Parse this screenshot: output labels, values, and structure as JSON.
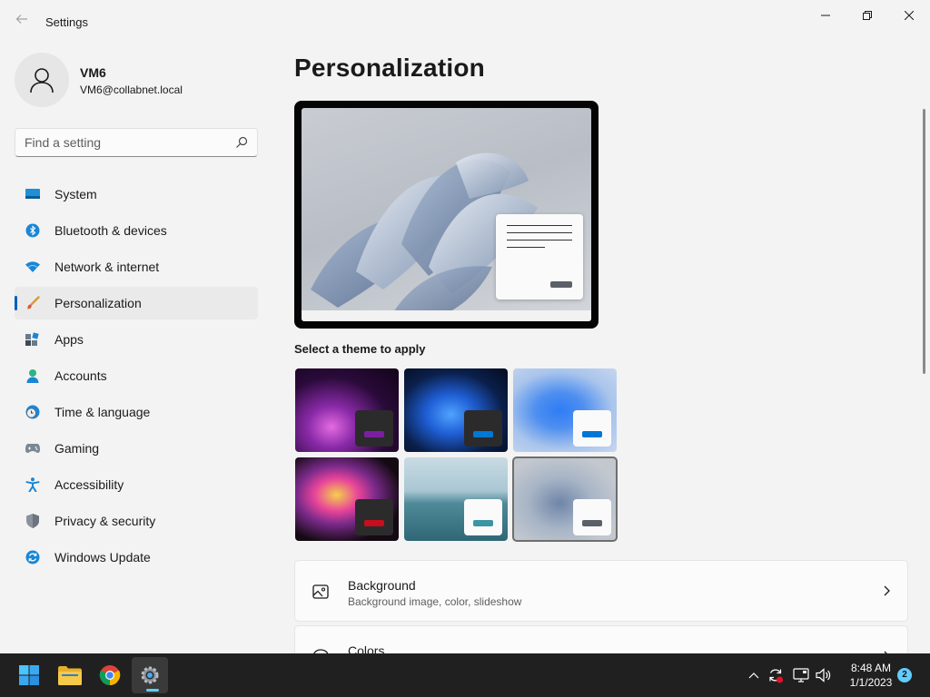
{
  "window": {
    "title": "Settings",
    "controls": [
      "minimize",
      "maximize",
      "close"
    ]
  },
  "profile": {
    "name": "VM6",
    "email": "VM6@collabnet.local"
  },
  "search": {
    "placeholder": "Find a setting",
    "value": ""
  },
  "sidebar": {
    "items": [
      {
        "label": "System",
        "icon": "system-icon"
      },
      {
        "label": "Bluetooth & devices",
        "icon": "bluetooth-icon"
      },
      {
        "label": "Network & internet",
        "icon": "wifi-icon"
      },
      {
        "label": "Personalization",
        "icon": "brush-icon",
        "selected": true
      },
      {
        "label": "Apps",
        "icon": "apps-icon"
      },
      {
        "label": "Accounts",
        "icon": "accounts-icon"
      },
      {
        "label": "Time & language",
        "icon": "clock-globe-icon"
      },
      {
        "label": "Gaming",
        "icon": "gamepad-icon"
      },
      {
        "label": "Accessibility",
        "icon": "accessibility-icon"
      },
      {
        "label": "Privacy & security",
        "icon": "shield-icon"
      },
      {
        "label": "Windows Update",
        "icon": "update-icon"
      }
    ]
  },
  "main": {
    "title": "Personalization",
    "theme_section_label": "Select a theme to apply",
    "themes": [
      {
        "name": "glow-purple",
        "accent": "#7a1fa2"
      },
      {
        "name": "bloom-dark",
        "accent": "#0078d4"
      },
      {
        "name": "bloom-light",
        "accent": "#0078d4"
      },
      {
        "name": "captured-motion",
        "accent": "#c50f1f"
      },
      {
        "name": "flow-lake",
        "accent": "#3a96a4"
      },
      {
        "name": "sunrise-gray",
        "accent": "#5c6068",
        "selected": true
      }
    ],
    "settings": [
      {
        "title": "Background",
        "subtitle": "Background image, color, slideshow",
        "icon": "image-icon"
      },
      {
        "title": "Colors",
        "subtitle": "",
        "icon": "palette-icon"
      }
    ]
  },
  "taskbar": {
    "apps": [
      "start-icon",
      "file-explorer-icon",
      "chrome-icon",
      "settings-app-icon"
    ],
    "tray": [
      "chevron-up-icon",
      "sync-error-icon",
      "network-icon",
      "volume-icon"
    ],
    "time": "8:48 AM",
    "date": "1/1/2023",
    "notification_count": "2"
  },
  "colors": {
    "accent": "#005fb8",
    "taskbar": "#202020",
    "background": "#f3f3f3"
  }
}
